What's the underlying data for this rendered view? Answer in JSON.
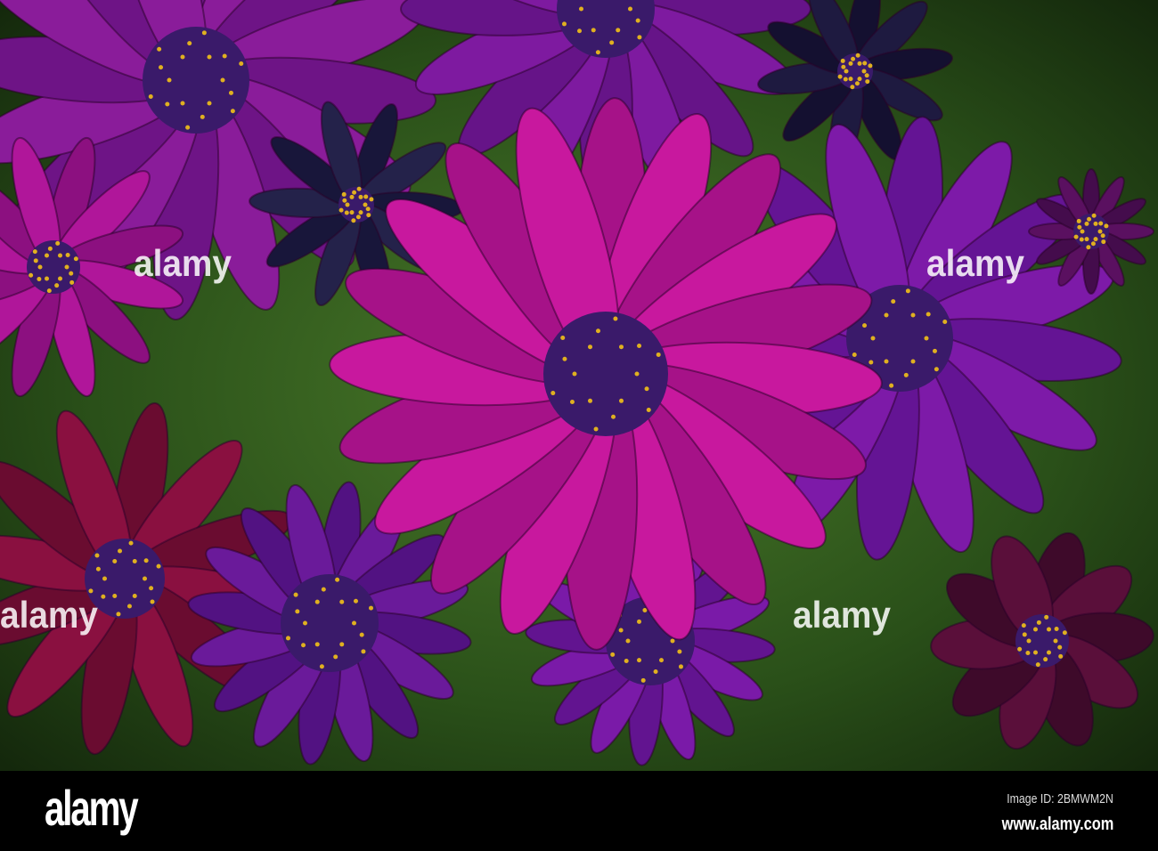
{
  "photo": {
    "subject": "purple-daisy-flowers",
    "colors": {
      "background": "#2f5a1e",
      "main_flower": "#c8189e",
      "purple_flower": "#7d1aa8",
      "dark_flower": "#6a0f3a",
      "center": "#3a1a6a",
      "pollen": "#e0b020"
    }
  },
  "watermark": {
    "text": "alamy"
  },
  "footer": {
    "logo": "alamy",
    "image_id": "Image ID: 2BMWM2N",
    "url": "www.alamy.com"
  }
}
